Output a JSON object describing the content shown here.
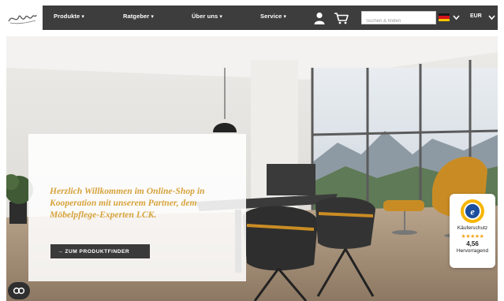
{
  "brand": {
    "logo_icon": "signature-logo-icon"
  },
  "nav": {
    "items": [
      {
        "label": "Produkte"
      },
      {
        "label": "Ratgeber"
      },
      {
        "label": "Über uns"
      },
      {
        "label": "Service"
      }
    ],
    "caret": "▾"
  },
  "header": {
    "user_icon": "user-icon",
    "cart_icon": "cart-icon",
    "search_placeholder": "Suchen & finden",
    "search_value": "",
    "language_flag": "flag-de-icon",
    "currency": "EUR",
    "bar_color": "#3d3d3d"
  },
  "hero": {
    "welcome": "Herzlich Willkommen im Online-Shop in Kooperation mit unserem Partner, dem Möbelpflege-Experten LCK.",
    "cta_label": "→ ZUM PRODUKTFINDER",
    "accent_color": "#d6a23a"
  },
  "trust_badge": {
    "label": "Käuferschutz",
    "stars": "★★★★★",
    "score": "4,56",
    "verdict": "Hervorragend",
    "seal_icon": "trusted-shops-seal-icon"
  },
  "cookie": {
    "icon": "cookie-settings-icon"
  }
}
